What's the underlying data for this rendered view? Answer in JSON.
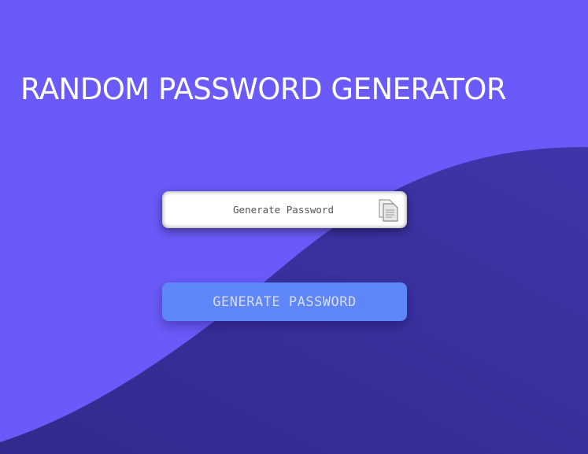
{
  "page": {
    "title": "RANDOM PASSWORD GENERATOR"
  },
  "password_field": {
    "value": "",
    "placeholder": "Generate Password"
  },
  "copy_icon": "clipboard-copy-icon",
  "generate_button": {
    "label": "GENERATE PASSWORD"
  },
  "colors": {
    "background": "#6a5af9",
    "wave": "#3b33a6",
    "button": "#5e86f7",
    "title": "#ffffff"
  }
}
